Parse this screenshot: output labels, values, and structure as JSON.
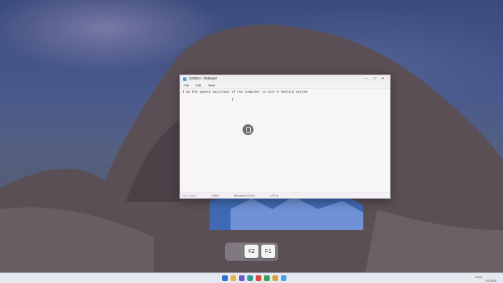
{
  "desktop": {
    "icons": [
      {
        "name": "folder-icon",
        "color": "#e6b54a"
      },
      {
        "name": "edge-icon",
        "color": "#3a8fd9"
      },
      {
        "name": "document-icon",
        "color": "#dfe6f2"
      }
    ]
  },
  "notepad": {
    "title": "Untitled - Notepad",
    "menu": [
      "File",
      "Edit",
      "View"
    ],
    "content": "I am the speech assistant of the computer in user's Android system",
    "status": {
      "position": "Ln 1, Col 1",
      "zoom": "100%",
      "line_ending": "Windows (CRLF)",
      "encoding": "UTF-8"
    }
  },
  "keys_overlay": {
    "keys": [
      "F2",
      "F1"
    ]
  },
  "taskbar": {
    "icons": [
      {
        "name": "start-icon",
        "color": "#2f6fd6"
      },
      {
        "name": "file-explorer-icon",
        "color": "#e6b54a"
      },
      {
        "name": "store-icon",
        "color": "#6a5acd"
      },
      {
        "name": "edge-icon",
        "color": "#2aa198"
      },
      {
        "name": "red-app-icon",
        "color": "#d94a3a"
      },
      {
        "name": "green-app-icon",
        "color": "#3aa05a"
      },
      {
        "name": "chrome-icon",
        "color": "#d9a23a"
      },
      {
        "name": "notepad-icon",
        "color": "#4aa3df"
      }
    ],
    "tray": {
      "time": "10:23",
      "date": "1/1/2024"
    }
  }
}
